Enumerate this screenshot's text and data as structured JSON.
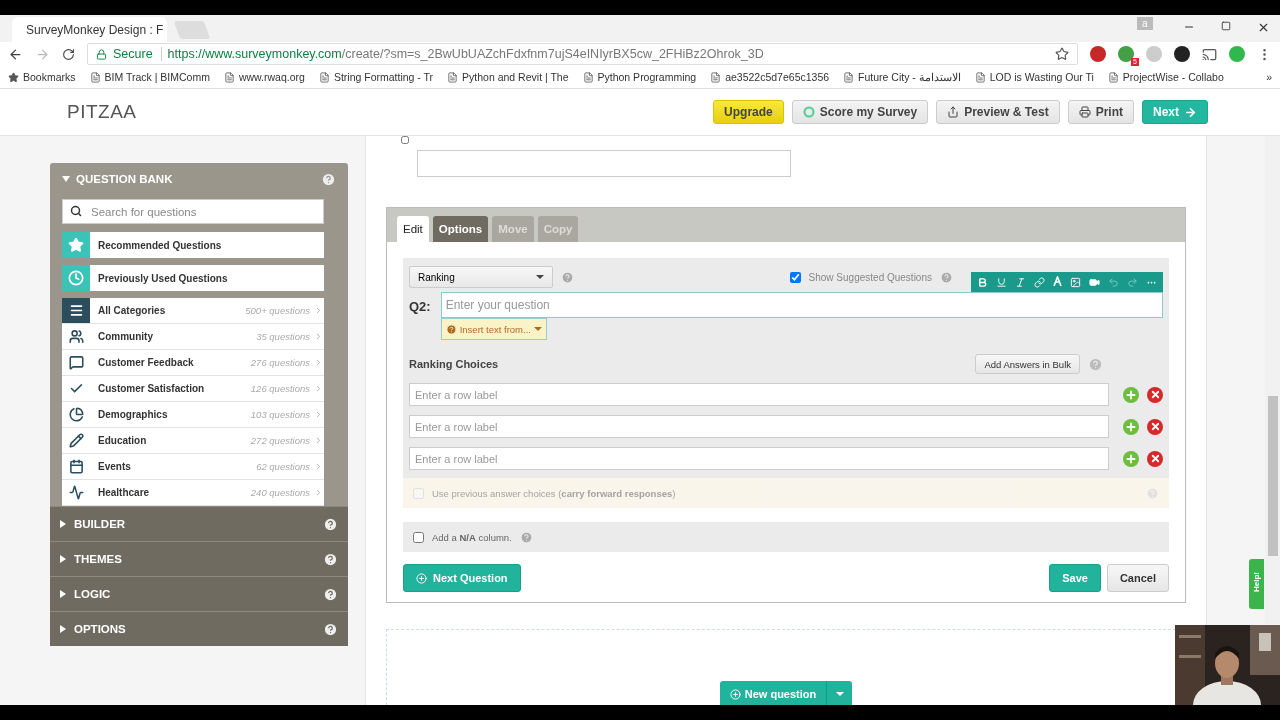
{
  "browser": {
    "tab_title": "SurveyMonkey Design : F",
    "profile": "a",
    "secure_label": "Secure",
    "url_host": "https://www.surveymonkey.com",
    "url_path": "/create/?sm=s_2BwUbUAZchFdxfnm7ujS4eINIyrBX5cw_2FHiBz2Ohrok_3D",
    "extension_badge": "5",
    "bookmarks": [
      "Bookmarks",
      "BIM Track | BIMComm",
      "www.rwaq.org",
      "String Formatting - Tr",
      "Python and Revit | The",
      "Python Programming",
      "ae3522c5d7e65c1356",
      "Future City - الاستدامة",
      "LOD is Wasting Our Ti",
      "ProjectWise - Collabo"
    ],
    "more": "»"
  },
  "header": {
    "logo": "PITZAA",
    "buttons": [
      {
        "label": "Upgrade",
        "kind": "upgrade"
      },
      {
        "label": "Score my Survey",
        "kind": "score"
      },
      {
        "label": "Preview & Test",
        "kind": "preview"
      },
      {
        "label": "Print",
        "kind": "print"
      },
      {
        "label": "Next",
        "kind": "next"
      }
    ]
  },
  "sidebar": {
    "question_bank": {
      "title": "QUESTION BANK",
      "expanded": true,
      "search_placeholder": "Search for questions",
      "shortcuts": [
        "Recommended Questions",
        "Previously Used Questions"
      ],
      "categories": [
        {
          "label": "All Categories",
          "count": "500+ questions",
          "selected": true
        },
        {
          "label": "Community",
          "count": "35 questions",
          "selected": false
        },
        {
          "label": "Customer Feedback",
          "count": "276 questions",
          "selected": false
        },
        {
          "label": "Customer Satisfaction",
          "count": "126 questions",
          "selected": false
        },
        {
          "label": "Demographics",
          "count": "103 questions",
          "selected": false
        },
        {
          "label": "Education",
          "count": "272 questions",
          "selected": false
        },
        {
          "label": "Events",
          "count": "62 questions",
          "selected": false
        },
        {
          "label": "Healthcare",
          "count": "240 questions",
          "selected": false
        }
      ]
    },
    "sections": [
      {
        "title": "BUILDER",
        "expanded": false
      },
      {
        "title": "THEMES",
        "expanded": false
      },
      {
        "title": "LOGIC",
        "expanded": false
      },
      {
        "title": "OPTIONS",
        "expanded": false
      }
    ]
  },
  "editor": {
    "tabs": [
      {
        "label": "Edit",
        "selected": true,
        "disabled": false
      },
      {
        "label": "Options",
        "selected": false,
        "disabled": false
      },
      {
        "label": "Move",
        "selected": false,
        "disabled": true
      },
      {
        "label": "Copy",
        "selected": false,
        "disabled": true
      }
    ],
    "question_type": "Ranking",
    "show_suggested": {
      "label": "Show Suggested Questions",
      "checked": true
    },
    "question_number": "Q2:",
    "question_placeholder": "Enter your question",
    "insert_text": "Insert text from...",
    "choices_title": "Ranking Choices",
    "bulk_button": "Add Answers in Bulk",
    "rows": [
      {
        "placeholder": "Enter a row label"
      },
      {
        "placeholder": "Enter a row label"
      },
      {
        "placeholder": "Enter a row label"
      }
    ],
    "carry_forward": {
      "label": "Use previous answer choices (**carry forward responses**)",
      "checked": false,
      "disabled": true
    },
    "na_column": {
      "label": "Add a **N/A** column.",
      "checked": false
    },
    "next_button": "Next Question",
    "save_button": "Save",
    "cancel_button": "Cancel"
  },
  "previous_question": {
    "checked": false
  },
  "new_question_button": "New question",
  "help_tab": "Help!"
}
